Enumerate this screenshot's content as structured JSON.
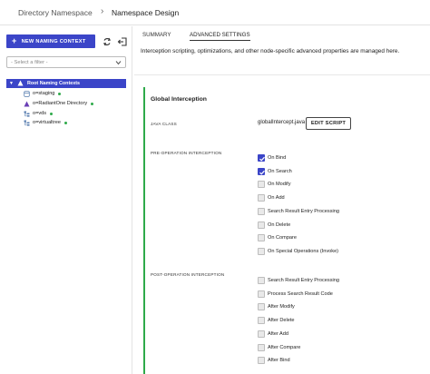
{
  "breadcrumb": {
    "parent": "Directory Namespace",
    "separator": "›",
    "current": "Namespace Design"
  },
  "sidebar": {
    "new_button_label": "NEW NAMING CONTEXT",
    "filter_placeholder": "- Select a filter -",
    "tree_root_label": "Root Naming Contexts",
    "tree_items": [
      {
        "label": "o=staging",
        "icon": "database-icon",
        "status": "online"
      },
      {
        "label": "o=RadiantOne Directory",
        "icon": "triangle-logo-icon",
        "status": "online"
      },
      {
        "label": "o=vds",
        "icon": "hierarchy-icon",
        "status": "online"
      },
      {
        "label": "o=virtualtree",
        "icon": "hierarchy-icon",
        "status": "online"
      }
    ]
  },
  "tabs": {
    "summary": "SUMMARY",
    "advanced": "ADVANCED SETTINGS"
  },
  "description": "Interception scripting, optimizations, and other node-specific advanced properties are managed here.",
  "global": {
    "title": "Global Interception",
    "java_class_label": "JAVA CLASS",
    "java_class_value": "globalIntercept.java",
    "edit_button": "EDIT SCRIPT"
  },
  "pre_operation": {
    "label": "PRE-OPERATION INTERCEPTION",
    "options": [
      {
        "label": "On Bind",
        "checked": true
      },
      {
        "label": "On Search",
        "checked": true
      },
      {
        "label": "On Modify",
        "checked": false
      },
      {
        "label": "On Add",
        "checked": false
      },
      {
        "label": "Search Result Entry Processing",
        "checked": false
      },
      {
        "label": "On Delete",
        "checked": false
      },
      {
        "label": "On Compare",
        "checked": false
      },
      {
        "label": "On Special Operations (Invoke)",
        "checked": false
      }
    ]
  },
  "post_operation": {
    "label": "POST-OPERATION INTERCEPTION",
    "options": [
      {
        "label": "Search Result Entry Processing",
        "checked": false
      },
      {
        "label": "Process Search Result Code",
        "checked": false
      },
      {
        "label": "After Modify",
        "checked": false
      },
      {
        "label": "After Delete",
        "checked": false
      },
      {
        "label": "After Add",
        "checked": false
      },
      {
        "label": "After Compare",
        "checked": false
      },
      {
        "label": "After Bind",
        "checked": false
      }
    ]
  },
  "colors": {
    "accent": "#3b45c8",
    "status_green": "#2eaa4a"
  }
}
